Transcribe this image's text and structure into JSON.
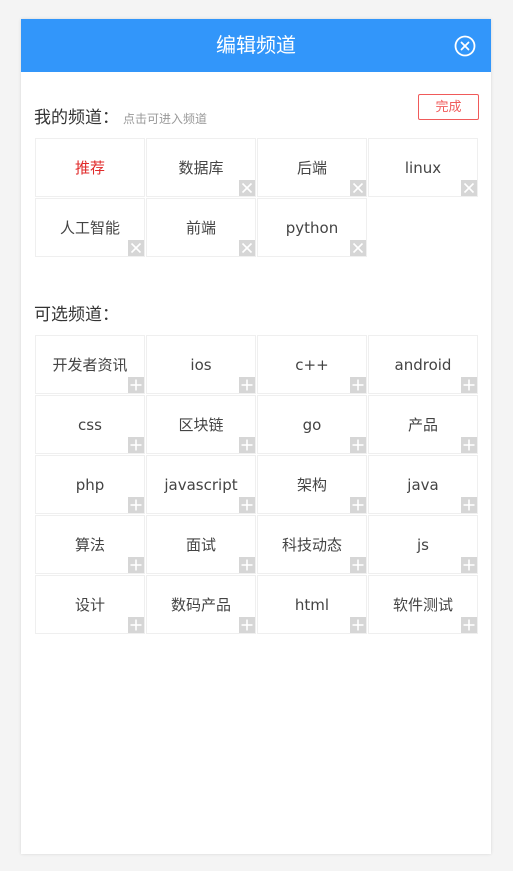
{
  "header": {
    "title": "编辑频道"
  },
  "my_channels": {
    "title": "我的频道：",
    "hint": "点击可进入频道",
    "done_label": "完成",
    "items": [
      {
        "label": "推荐",
        "active": true,
        "removable": false
      },
      {
        "label": "数据库",
        "active": false,
        "removable": true
      },
      {
        "label": "后端",
        "active": false,
        "removable": true
      },
      {
        "label": "linux",
        "active": false,
        "removable": true
      },
      {
        "label": "人工智能",
        "active": false,
        "removable": true
      },
      {
        "label": "前端",
        "active": false,
        "removable": true
      },
      {
        "label": "python",
        "active": false,
        "removable": true
      }
    ]
  },
  "optional_channels": {
    "title": "可选频道：",
    "items": [
      {
        "label": "开发者资讯"
      },
      {
        "label": "ios"
      },
      {
        "label": "c++"
      },
      {
        "label": "android"
      },
      {
        "label": "css"
      },
      {
        "label": "区块链"
      },
      {
        "label": "go"
      },
      {
        "label": "产品"
      },
      {
        "label": "php"
      },
      {
        "label": "javascript"
      },
      {
        "label": "架构"
      },
      {
        "label": "java"
      },
      {
        "label": "算法"
      },
      {
        "label": "面试"
      },
      {
        "label": "科技动态"
      },
      {
        "label": "js"
      },
      {
        "label": "设计"
      },
      {
        "label": "数码产品"
      },
      {
        "label": "html"
      },
      {
        "label": "软件测试"
      }
    ]
  },
  "colors": {
    "header_bg": "#3296fa",
    "active_text": "#e02a2a",
    "done_border": "#f05a5a",
    "badge_bg": "#d6d6d6"
  },
  "icons": {
    "close": "close-circle-icon",
    "remove": "remove-x-icon",
    "add": "add-plus-icon"
  }
}
